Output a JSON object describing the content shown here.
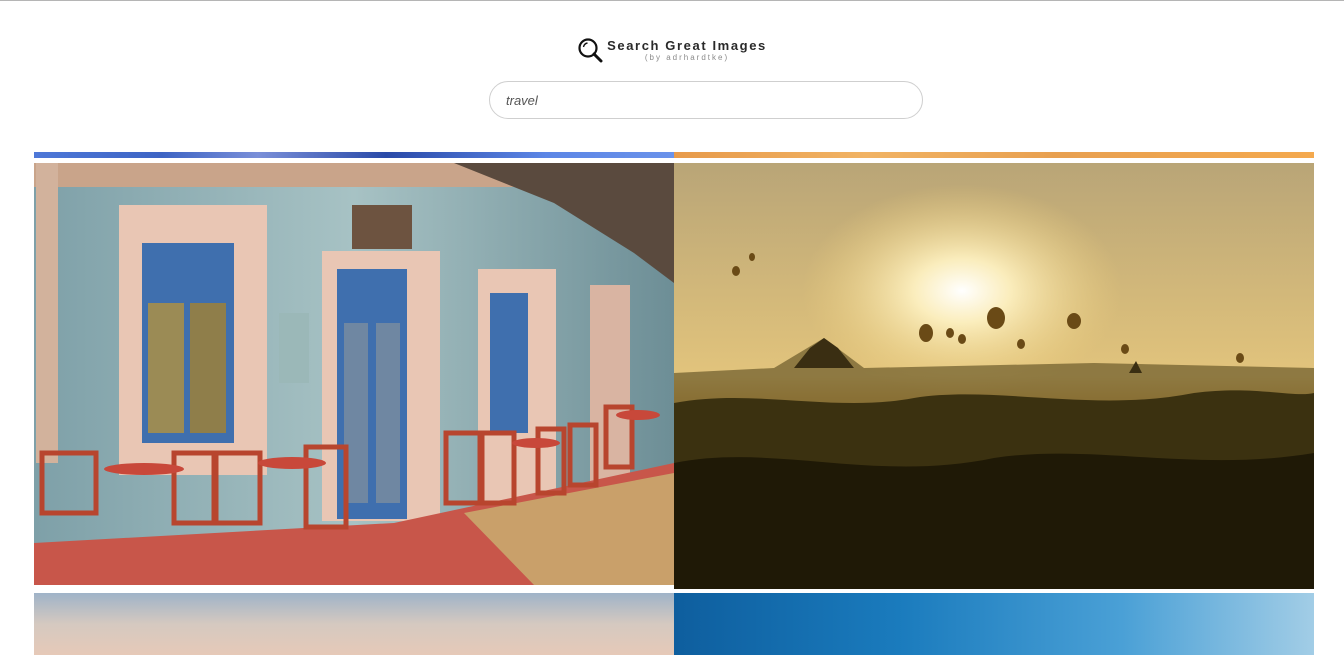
{
  "header": {
    "title": "Search Great Images",
    "subtitle": "(by adrhardtke)",
    "icon": "magnifier-icon"
  },
  "search": {
    "value": "travel"
  },
  "results": [
    {
      "name": "greek-cafe-facade",
      "colors": {
        "wall": "#8aa8b0",
        "door": "#3f6fae",
        "chairs": "#b8452e",
        "floor": "#c8564a"
      }
    },
    {
      "name": "bagan-balloons-sunrise",
      "colors": {
        "sky": "#d9b870",
        "sun": "#fff6d6",
        "ground": "#2a2210"
      }
    },
    {
      "name": "pastel-sky-landscape",
      "colors": {
        "top": "#9fb3c8",
        "bottom": "#e6c9b8"
      }
    },
    {
      "name": "blue-water-splash",
      "colors": {
        "left": "#0e5e9e",
        "right": "#a2cde6"
      }
    }
  ]
}
